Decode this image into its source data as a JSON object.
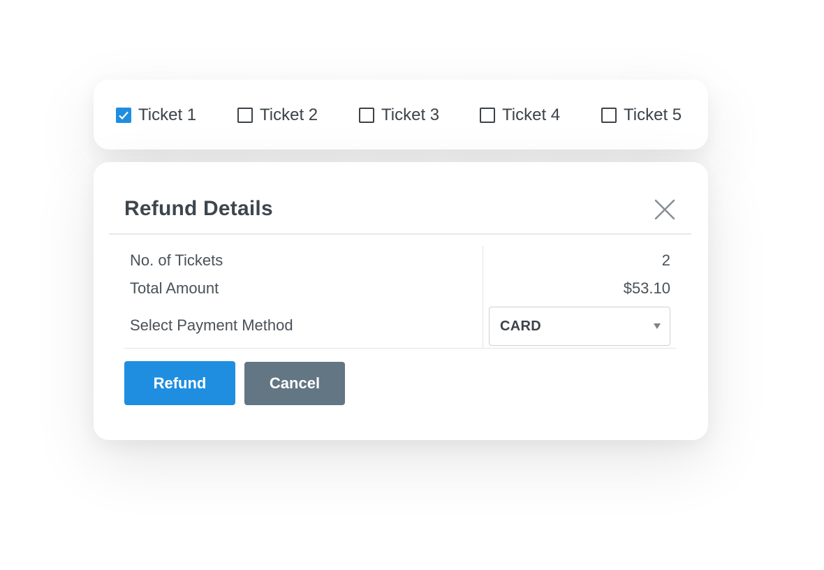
{
  "tickets": [
    {
      "label": "Ticket 1",
      "checked": true
    },
    {
      "label": "Ticket 2",
      "checked": false
    },
    {
      "label": "Ticket 3",
      "checked": false
    },
    {
      "label": "Ticket 4",
      "checked": false
    },
    {
      "label": "Ticket 5",
      "checked": false
    }
  ],
  "dialog": {
    "title": "Refund Details",
    "close_icon": "close-icon",
    "rows": {
      "tickets_label": "No. of Tickets",
      "tickets_value": "2",
      "amount_label": "Total Amount",
      "amount_value": "$53.10",
      "payment_label": "Select Payment Method",
      "payment_value": "CARD"
    },
    "buttons": {
      "refund_label": "Refund",
      "cancel_label": "Cancel"
    }
  },
  "colors": {
    "primary": "#1f8ee0",
    "secondary": "#627684",
    "text": "#40474e"
  }
}
